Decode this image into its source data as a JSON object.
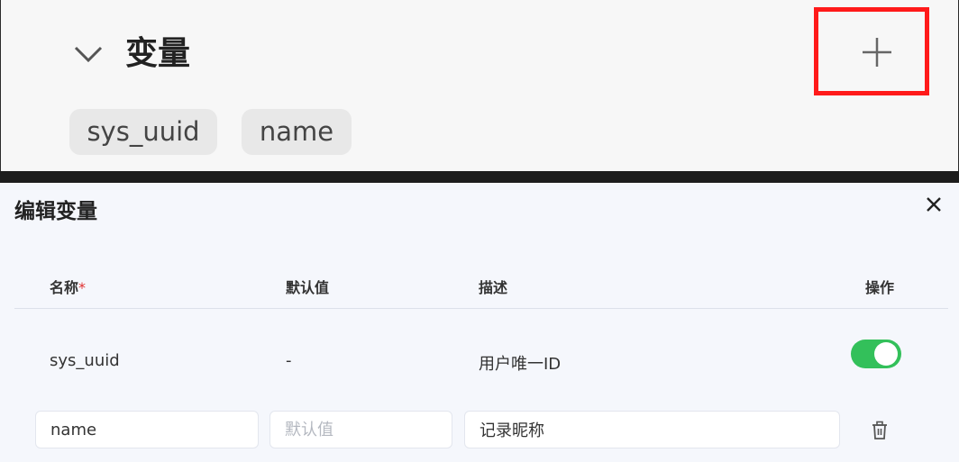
{
  "variables_section": {
    "title": "变量",
    "chips": [
      "sys_uuid",
      "name"
    ]
  },
  "dialog": {
    "title": "编辑变量",
    "columns": {
      "name": "名称",
      "required_mark": "*",
      "default": "默认值",
      "description": "描述",
      "actions": "操作"
    },
    "rows": [
      {
        "name": "sys_uuid",
        "default": "-",
        "description": "用户唯一ID",
        "enabled": true
      }
    ],
    "edit_row": {
      "name_value": "name",
      "default_placeholder": "默认值",
      "description_value": "记录昵称"
    }
  },
  "colors": {
    "highlight": "#ff1a1a",
    "toggle_on": "#33c05a",
    "required": "#e03131"
  }
}
